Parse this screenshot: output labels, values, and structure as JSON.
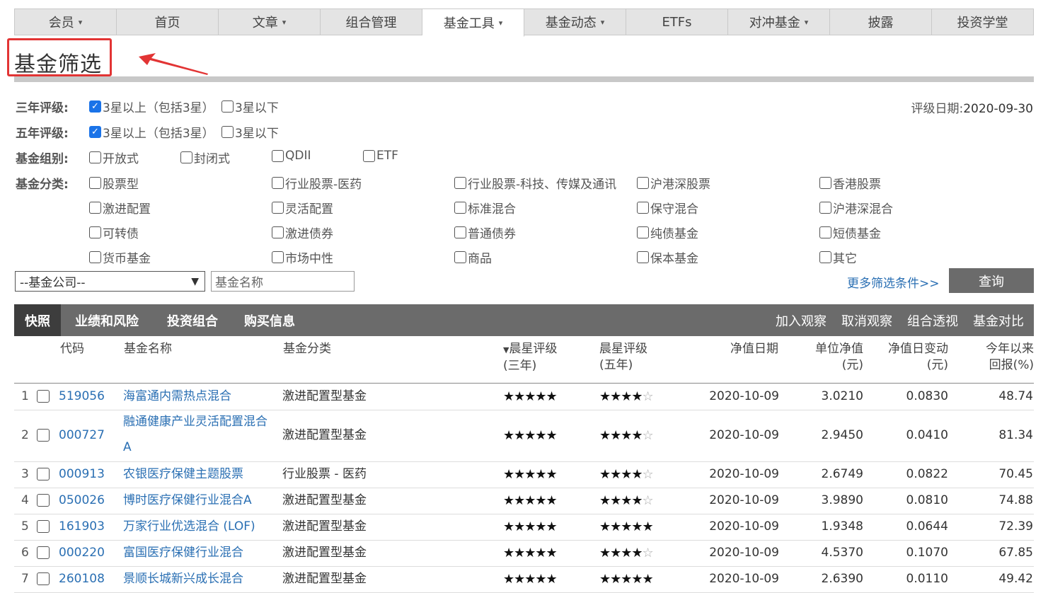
{
  "nav": [
    {
      "label": "会员",
      "caret": true
    },
    {
      "label": "首页",
      "caret": false
    },
    {
      "label": "文章",
      "caret": true
    },
    {
      "label": "组合管理",
      "caret": false
    },
    {
      "label": "基金工具",
      "caret": true,
      "active": true
    },
    {
      "label": "基金动态",
      "caret": true
    },
    {
      "label": "ETFs",
      "caret": false
    },
    {
      "label": "对冲基金",
      "caret": true
    },
    {
      "label": "披露",
      "caret": false
    },
    {
      "label": "投资学堂",
      "caret": false
    }
  ],
  "page_title": "基金筛选",
  "annotation_color": "#e23434",
  "filters": {
    "three_year": {
      "label": "三年评级:",
      "opt1": "3星以上（包括3星）",
      "opt2": "3星以下"
    },
    "five_year": {
      "label": "五年评级:",
      "opt1": "3星以上（包括3星）",
      "opt2": "3星以下"
    },
    "group": {
      "label": "基金组别:",
      "opts": [
        "开放式",
        "封闭式",
        "QDII",
        "ETF"
      ]
    },
    "category": {
      "label": "基金分类:",
      "opts": [
        "股票型",
        "行业股票-医药",
        "行业股票-科技、传媒及通讯",
        "沪港深股票",
        "香港股票",
        "激进配置",
        "灵活配置",
        "标准混合",
        "保守混合",
        "沪港深混合",
        "可转债",
        "激进债券",
        "普通债券",
        "纯债基金",
        "短债基金",
        "货币基金",
        "市场中性",
        "商品",
        "保本基金",
        "其它"
      ]
    }
  },
  "rating_date": {
    "label": "评级日期:",
    "value": "2020-09-30"
  },
  "company_select": "--基金公司--",
  "name_placeholder": "基金名称",
  "more_filters": "更多筛选条件>>",
  "query_button": "查询",
  "tabs": [
    "快照",
    "业绩和风险",
    "投资组合",
    "购买信息"
  ],
  "actions": [
    "加入观察",
    "取消观察",
    "组合透视",
    "基金对比"
  ],
  "columns": {
    "code": "代码",
    "name": "基金名称",
    "category": "基金分类",
    "r3a": "晨星评级",
    "r3b": "(三年)",
    "r5a": "晨星评级",
    "r5b": "(五年)",
    "date": "净值日期",
    "nav_a": "单位净值",
    "nav_b": "(元)",
    "chg_a": "净值日变动",
    "chg_b": "(元)",
    "ytd_a": "今年以来",
    "ytd_b": "回报(%)"
  },
  "rows": [
    {
      "idx": "1",
      "code": "519056",
      "name": "海富通内需热点混合",
      "name2": "",
      "category": "激进配置型基金",
      "r3": 5,
      "r5": 4,
      "date": "2020-10-09",
      "nav": "3.0210",
      "chg": "0.0830",
      "ytd": "48.74"
    },
    {
      "idx": "2",
      "code": "000727",
      "name": "融通健康产业灵活配置混合",
      "name2": "A",
      "category": "激进配置型基金",
      "r3": 5,
      "r5": 4,
      "date": "2020-10-09",
      "nav": "2.9450",
      "chg": "0.0410",
      "ytd": "81.34"
    },
    {
      "idx": "3",
      "code": "000913",
      "name": "农银医疗保健主题股票",
      "name2": "",
      "category": "行业股票 - 医药",
      "r3": 5,
      "r5": 4,
      "date": "2020-10-09",
      "nav": "2.6749",
      "chg": "0.0822",
      "ytd": "70.45"
    },
    {
      "idx": "4",
      "code": "050026",
      "name": "博时医疗保健行业混合A",
      "name2": "",
      "category": "激进配置型基金",
      "r3": 5,
      "r5": 4,
      "date": "2020-10-09",
      "nav": "3.9890",
      "chg": "0.0810",
      "ytd": "74.88"
    },
    {
      "idx": "5",
      "code": "161903",
      "name": "万家行业优选混合 (LOF)",
      "name2": "",
      "category": "激进配置型基金",
      "r3": 5,
      "r5": 5,
      "date": "2020-10-09",
      "nav": "1.9348",
      "chg": "0.0644",
      "ytd": "72.39"
    },
    {
      "idx": "6",
      "code": "000220",
      "name": "富国医疗保健行业混合",
      "name2": "",
      "category": "激进配置型基金",
      "r3": 5,
      "r5": 4,
      "date": "2020-10-09",
      "nav": "4.5370",
      "chg": "0.1070",
      "ytd": "67.85"
    },
    {
      "idx": "7",
      "code": "260108",
      "name": "景顺长城新兴成长混合",
      "name2": "",
      "category": "激进配置型基金",
      "r3": 5,
      "r5": 5,
      "date": "2020-10-09",
      "nav": "2.6390",
      "chg": "0.0110",
      "ytd": "49.42"
    }
  ]
}
